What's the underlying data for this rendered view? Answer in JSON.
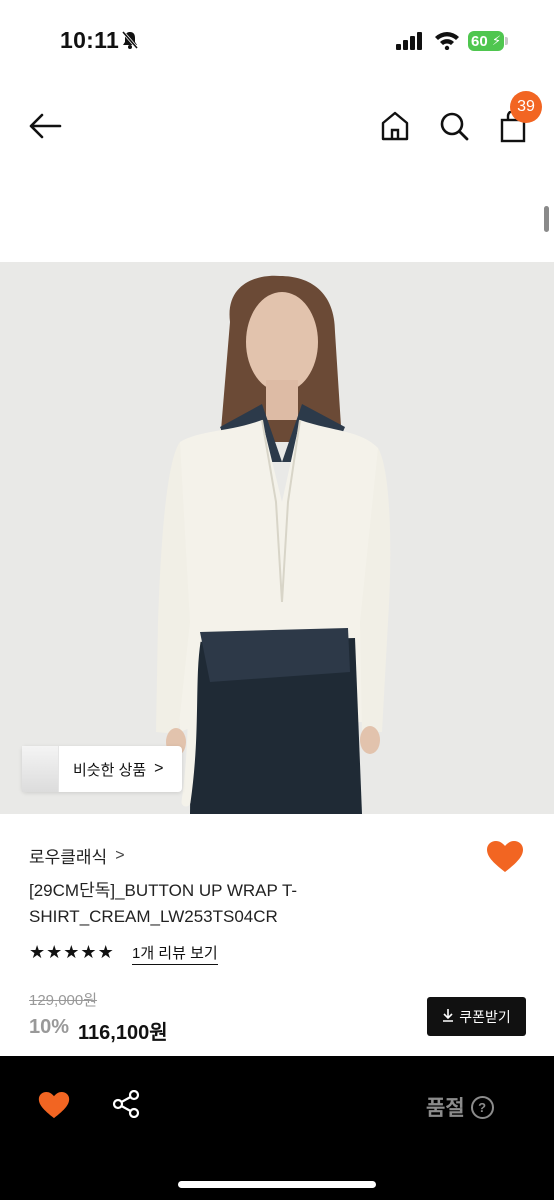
{
  "status_bar": {
    "time": "10:11",
    "battery": "60"
  },
  "nav": {
    "cart_count": "39"
  },
  "hero": {
    "similar_label": "비슷한 상품",
    "similar_chevron": ">"
  },
  "product": {
    "brand": "로우클래식",
    "brand_chevron": ">",
    "title": "[29CM단독]_BUTTON UP WRAP T-SHIRT_CREAM_LW253TS04CR",
    "rating_stars": 5,
    "reviews_label": "1개 리뷰 보기",
    "original_price": "129,000원",
    "discount": "10%",
    "price": "116,100원",
    "coupon_label": "쿠폰받기"
  },
  "bottom_bar": {
    "sold_out_label": "품절",
    "help_icon": "?"
  },
  "colors": {
    "accent": "#f26522",
    "bottom_bar": "#000000",
    "muted": "#8c8c8c"
  }
}
